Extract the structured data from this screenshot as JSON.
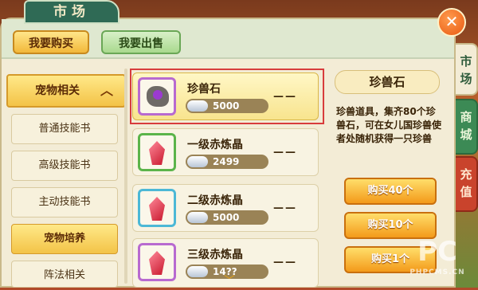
{
  "window": {
    "title": "市场",
    "close_label": "✕"
  },
  "top_tabs": {
    "buy": "我要购买",
    "sell": "我要出售"
  },
  "side_tabs": [
    "市场",
    "商城",
    "充值"
  ],
  "categories": {
    "group": "宠物相关",
    "items": [
      "普通技能书",
      "高级技能书",
      "主动技能书",
      "宠物培养",
      "阵法相关"
    ]
  },
  "items": [
    {
      "name": "珍兽石",
      "price": "5000",
      "qty": "——",
      "icon": "pet-stone-icon"
    },
    {
      "name": "一级赤炼晶",
      "price": "2499",
      "qty": "——",
      "icon": "red-crystal-icon"
    },
    {
      "name": "二级赤炼晶",
      "price": "5000",
      "qty": "——",
      "icon": "red-crystal-icon"
    },
    {
      "name": "三级赤炼晶",
      "price": "14??",
      "qty": "——",
      "icon": "red-crystal-icon"
    }
  ],
  "detail": {
    "title": "珍兽石",
    "description": "珍兽道具，集齐80个珍兽石，可在女儿国珍兽使者处随机获得一只珍兽"
  },
  "buy_buttons": [
    "购买40个",
    "购买10个",
    "购买1个"
  ],
  "watermark": {
    "main": "PC",
    "sub": "PHPCMS.CN"
  },
  "colors": {
    "accent": "#f39a1a",
    "selected_border": "#d83c3c",
    "panel": "#f3ecd6"
  }
}
